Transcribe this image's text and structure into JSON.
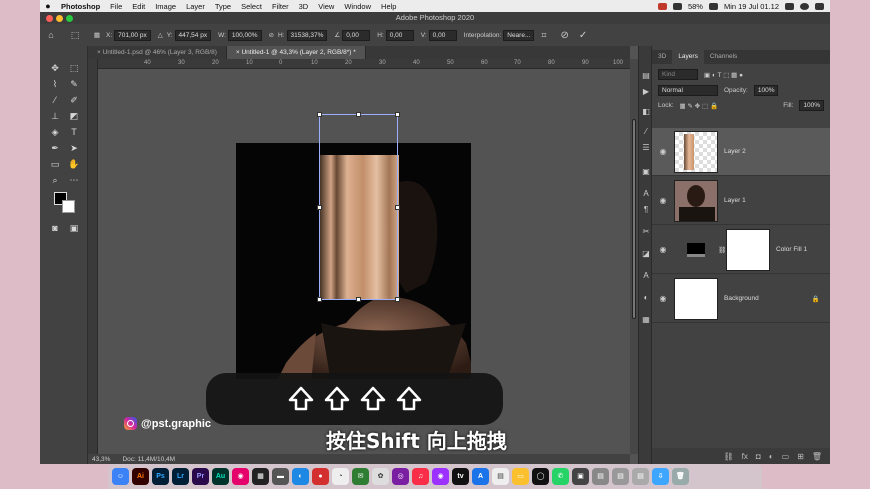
{
  "menubar": {
    "app": "Photoshop",
    "items": [
      "File",
      "Edit",
      "Image",
      "Layer",
      "Type",
      "Select",
      "Filter",
      "3D",
      "View",
      "Window",
      "Help"
    ],
    "battery": "58%",
    "clock": "Min 19 Jul  01.12"
  },
  "window": {
    "title": "Adobe Photoshop 2020"
  },
  "options": {
    "x_label": "X:",
    "x": "701,00 px",
    "y_label": "Y:",
    "y": "447,54 px",
    "w_label": "W:",
    "w": "100,00%",
    "h_label": "H:",
    "h": "31538,37%",
    "angle": "0,00",
    "hskew_label": "H:",
    "hskew": "0,00",
    "vskew_label": "V:",
    "vskew": "0,00",
    "interp_label": "Interpolation:",
    "interp": "Neare..."
  },
  "tabs": [
    {
      "label": "Untitled-1.psd @ 46% (Layer 3, RGB/8)"
    },
    {
      "label": "Untitled-1 @ 43,3% (Layer 2, RGB/8*) *"
    }
  ],
  "ruler": {
    "h_ticks": [
      "40",
      "30",
      "20",
      "10",
      "0",
      "10",
      "20",
      "30",
      "40",
      "50",
      "60",
      "70",
      "80",
      "90",
      "100",
      "110"
    ]
  },
  "status": {
    "zoom": "43,3%",
    "doc": "Doc: 11,4M/10,4M"
  },
  "panel": {
    "tabs": [
      "3D",
      "Layers",
      "Channels"
    ],
    "search_placeholder": "Kind",
    "blend": "Normal",
    "opacity_label": "Opacity:",
    "opacity": "100%",
    "lock_label": "Lock:",
    "fill_label": "Fill:",
    "fill": "100%",
    "layers": [
      {
        "name": "Layer 2"
      },
      {
        "name": "Layer 1"
      },
      {
        "name": "Color Fill 1"
      },
      {
        "name": "Background"
      }
    ]
  },
  "overlay": {
    "caption": "按住Shift 向上拖拽",
    "watermark": "@pst.graphic"
  },
  "dock": {
    "apps": [
      {
        "label": "Ai",
        "color": "#ff7c00"
      },
      {
        "label": "Ps",
        "color": "#31a8ff"
      },
      {
        "label": "Lr",
        "color": "#31a8ff"
      },
      {
        "label": "Pr",
        "color": "#9999ff"
      },
      {
        "label": "Au",
        "color": "#00e4bb"
      }
    ]
  },
  "colors": {
    "selection": "#9ab0ff",
    "panel": "#424242",
    "canvas": "#535353"
  }
}
